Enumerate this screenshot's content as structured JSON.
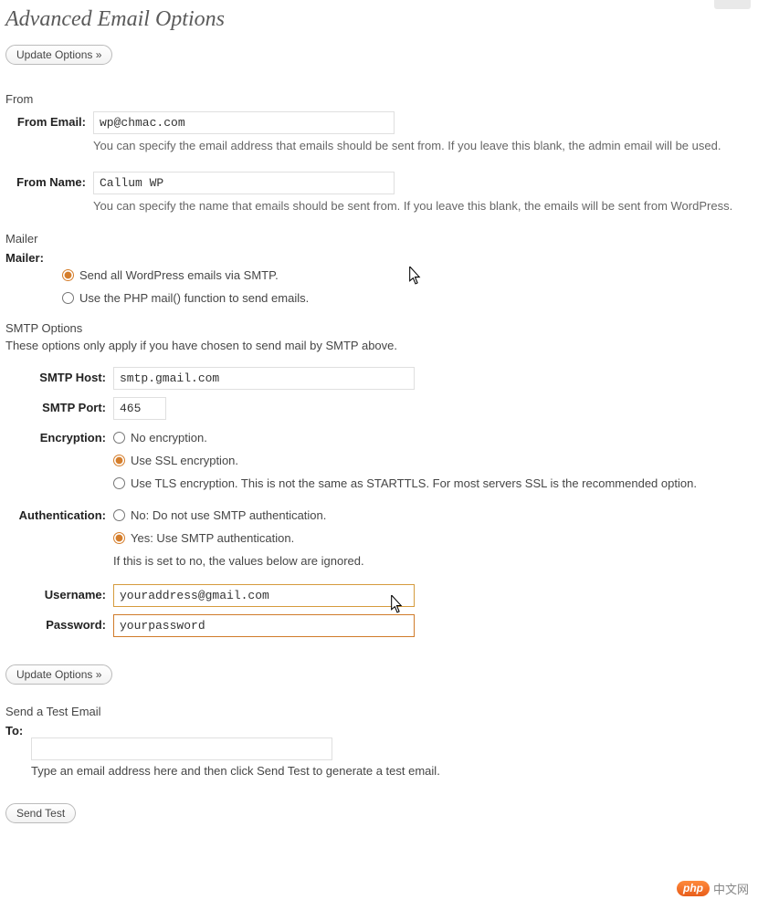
{
  "page": {
    "title": "Advanced Email Options"
  },
  "buttons": {
    "update_options": "Update Options »",
    "send_test": "Send Test"
  },
  "from": {
    "heading": "From",
    "email_label": "From Email:",
    "email_value": "wp@chmac.com",
    "email_desc": "You can specify the email address that emails should be sent from. If you leave this blank, the admin email will be used.",
    "name_label": "From Name:",
    "name_value": "Callum WP",
    "name_desc": "You can specify the name that emails should be sent from. If you leave this blank, the emails will be sent from WordPress."
  },
  "mailer": {
    "heading": "Mailer",
    "label": "Mailer:",
    "option_smtp": "Send all WordPress emails via SMTP.",
    "option_php": "Use the PHP mail() function to send emails."
  },
  "smtp": {
    "heading": "SMTP Options",
    "desc": "These options only apply if you have chosen to send mail by SMTP above.",
    "host_label": "SMTP Host:",
    "host_value": "smtp.gmail.com",
    "port_label": "SMTP Port:",
    "port_value": "465",
    "encryption_label": "Encryption:",
    "enc_none": "No encryption.",
    "enc_ssl": "Use SSL encryption.",
    "enc_tls": "Use TLS encryption. This is not the same as STARTTLS. For most servers SSL is the recommended option.",
    "auth_label": "Authentication:",
    "auth_no": "No: Do not use SMTP authentication.",
    "auth_yes": "Yes: Use SMTP authentication.",
    "auth_note": "If this is set to no, the values below are ignored.",
    "username_label": "Username:",
    "username_value": "youraddress@gmail.com",
    "password_label": "Password:",
    "password_value": "yourpassword"
  },
  "test": {
    "heading": "Send a Test Email",
    "to_label": "To:",
    "to_value": "",
    "desc": "Type an email address here and then click Send Test to generate a test email."
  },
  "watermark": {
    "badge": "php",
    "text": "中文网"
  }
}
